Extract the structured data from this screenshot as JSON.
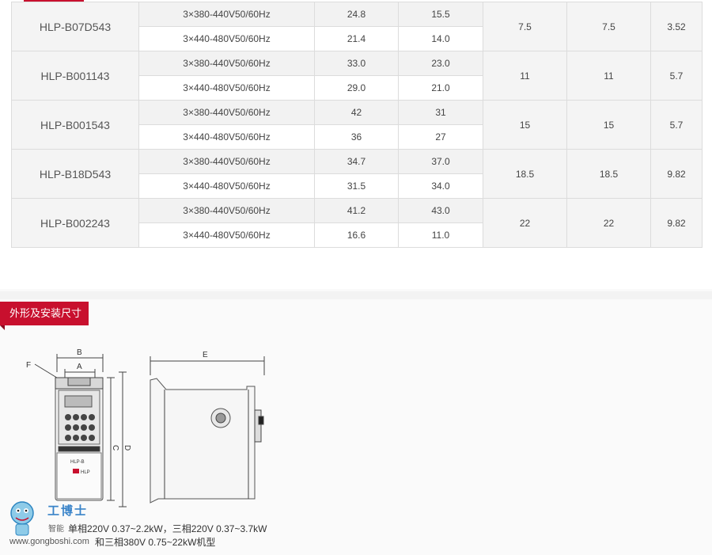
{
  "table": {
    "rows": [
      {
        "model": "HLP-B07D543",
        "v1": "3×380-440V50/60Hz",
        "a1": "24.8",
        "b1": "15.5",
        "v2": "3×440-480V50/60Hz",
        "a2": "21.4",
        "b2": "14.0",
        "c": "7.5",
        "d": "7.5",
        "e": "3.52"
      },
      {
        "model": "HLP-B001143",
        "v1": "3×380-440V50/60Hz",
        "a1": "33.0",
        "b1": "23.0",
        "v2": "3×440-480V50/60Hz",
        "a2": "29.0",
        "b2": "21.0",
        "c": "11",
        "d": "11",
        "e": "5.7"
      },
      {
        "model": "HLP-B001543",
        "v1": "3×380-440V50/60Hz",
        "a1": "42",
        "b1": "31",
        "v2": "3×440-480V50/60Hz",
        "a2": "36",
        "b2": "27",
        "c": "15",
        "d": "15",
        "e": "5.7"
      },
      {
        "model": "HLP-B18D543",
        "v1": "3×380-440V50/60Hz",
        "a1": "34.7",
        "b1": "37.0",
        "v2": "3×440-480V50/60Hz",
        "a2": "31.5",
        "b2": "34.0",
        "c": "18.5",
        "d": "18.5",
        "e": "9.82"
      },
      {
        "model": "HLP-B002243",
        "v1": "3×380-440V50/60Hz",
        "a1": "41.2",
        "b1": "43.0",
        "v2": "3×440-480V50/60Hz",
        "a2": "16.6",
        "b2": "11.0",
        "c": "22",
        "d": "22",
        "e": "9.82"
      }
    ]
  },
  "section": {
    "title": "外形及安装尺寸"
  },
  "drawing": {
    "front_labels": {
      "b": "B",
      "a": "A",
      "f": "F",
      "c": "C",
      "d": "D"
    },
    "side_labels": {
      "e": "E"
    },
    "device_brand": "HLP-B",
    "device_logo": "HLP"
  },
  "watermark": {
    "name": "工博士",
    "small": "智能",
    "url": "www.gongboshi.com"
  },
  "caption": {
    "line1": "单相220V 0.37~2.2kW，三相220V 0.37~3.7kW",
    "line2": "和三相380V 0.75~22kW机型"
  }
}
